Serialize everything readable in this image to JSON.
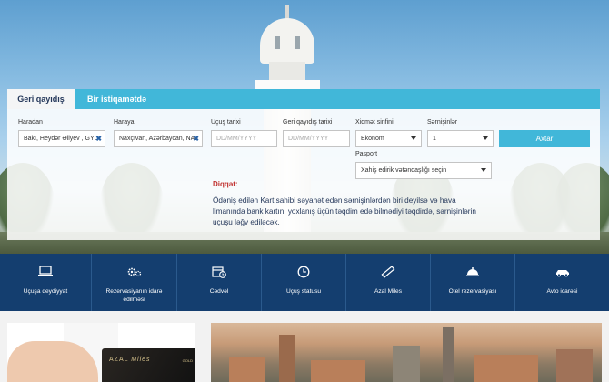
{
  "tabs": {
    "active": "Geri qayıdış",
    "inactive": "Bir istiqamətdə"
  },
  "form": {
    "from_label": "Haradan",
    "from_value": "Bakı, Heydər Əliyev , GYD",
    "to_label": "Haraya",
    "to_value": "Naxçıvan, Azərbaycan, NAJ",
    "depart_label": "Uçuş tarixi",
    "depart_placeholder": "DD/MM/YYYY",
    "return_label": "Geri qayıdış tarixi",
    "return_placeholder": "DD/MM/YYYY",
    "class_label": "Xidmət sinfini",
    "class_value": "Ekonom",
    "pax_label": "Sərnişinlər",
    "pax_value": "1",
    "search_label": "Axtar",
    "passport_label": "Pasport",
    "passport_value": "Xahiş edirik vətəndaşlığı seçin"
  },
  "notice": {
    "title": "Diqqət:",
    "text": "Ödəniş edilən Kart sahibi səyahət edən sərnişinlərdən biri deyilsə və hava limanında bank kartını yoxlanış üçün təqdim edə bilmədiyi təqdirdə, sərnişinlərin uçuşu ləğv ediləcək."
  },
  "nav": [
    {
      "label": "Uçuşa qeydiyyat",
      "icon": "laptop-icon"
    },
    {
      "label": "Rezervasiyanın idarə edilməsi",
      "icon": "gears-icon"
    },
    {
      "label": "Cədvəl",
      "icon": "calendar-clock-icon"
    },
    {
      "label": "Uçuş statusu",
      "icon": "clock-icon"
    },
    {
      "label": "Azal Miles",
      "icon": "ruler-icon"
    },
    {
      "label": "Otel rezervasiyası",
      "icon": "cloche-icon"
    },
    {
      "label": "Avto icarəsi",
      "icon": "car-icon"
    }
  ],
  "promo": {
    "card_brand": "AZAL",
    "card_script": "Miles",
    "card_tier": "GOLD"
  },
  "colors": {
    "accent": "#41b7d9",
    "nav": "#143e6f",
    "notice_title": "#c0302e",
    "text_dark": "#24375a"
  }
}
